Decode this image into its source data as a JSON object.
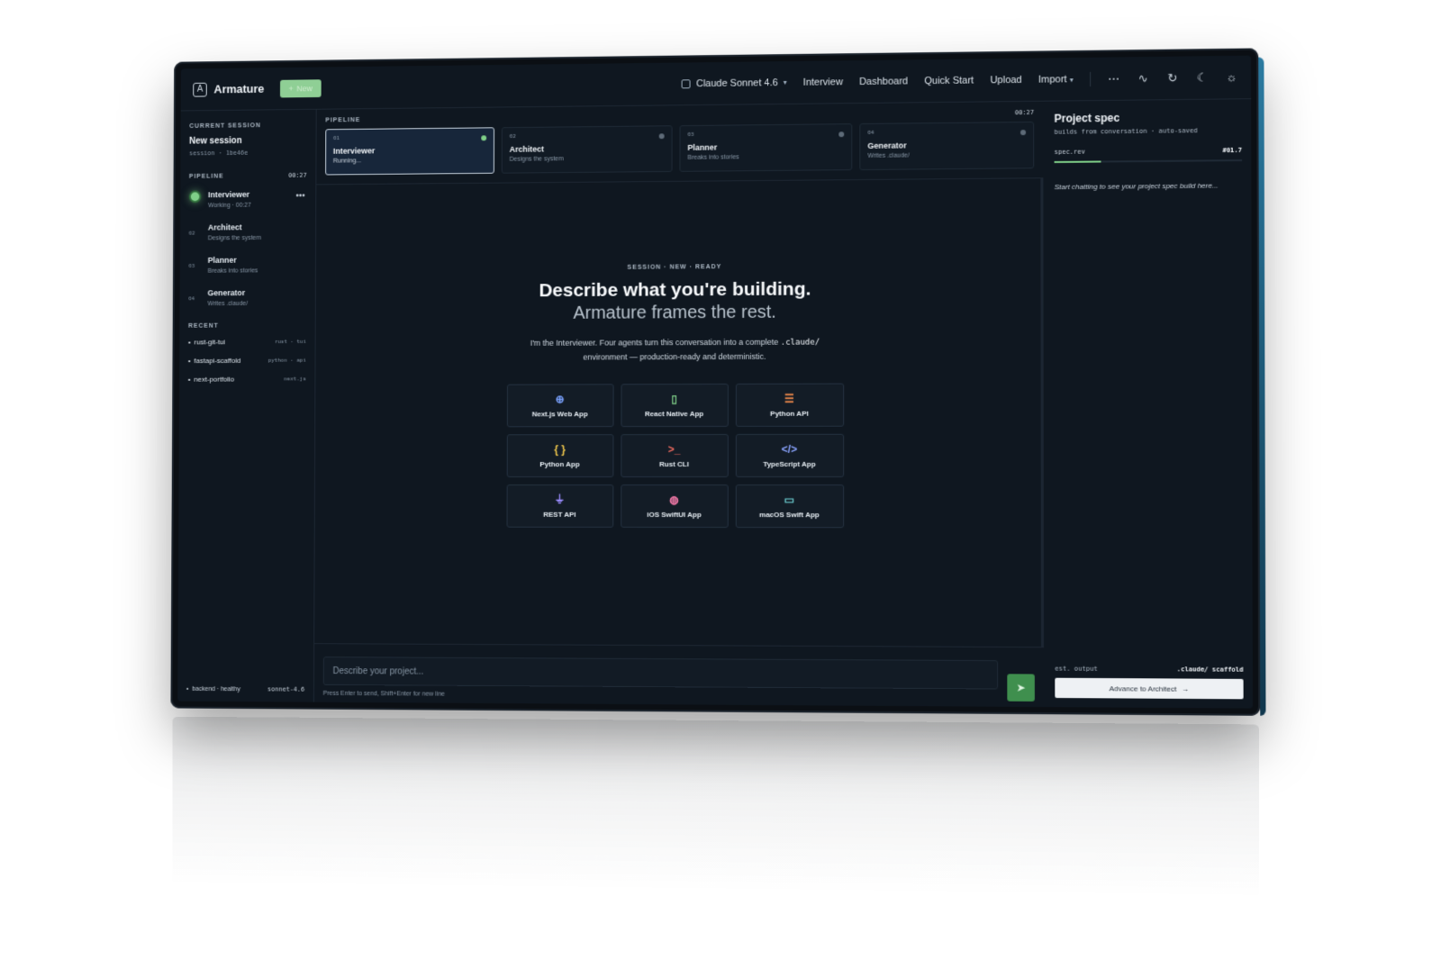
{
  "header": {
    "brand": "Armature",
    "new_label": "New",
    "model": "Claude Sonnet 4.6",
    "nav": [
      "Interview",
      "Dashboard",
      "Quick Start",
      "Upload",
      "Import"
    ],
    "icons": [
      "more-icon",
      "activity-icon",
      "refresh-icon",
      "moon-icon",
      "sun-icon"
    ]
  },
  "sidebar": {
    "current_kicker": "CURRENT SESSION",
    "session_title": "New session",
    "session_id": "session · 1be46e",
    "pipeline_kicker": "PIPELINE",
    "pipeline_time": "00:27",
    "stages": [
      {
        "num": "01",
        "name": "Interviewer",
        "sub": "Working · 00:27",
        "active": true
      },
      {
        "num": "02",
        "name": "Architect",
        "sub": "Designs the system"
      },
      {
        "num": "03",
        "name": "Planner",
        "sub": "Breaks into stories"
      },
      {
        "num": "04",
        "name": "Generator",
        "sub": "Writes .claude/"
      }
    ],
    "recent_kicker": "RECENT",
    "recent": [
      {
        "name": "rust-git-tui",
        "tag": "rust · tui"
      },
      {
        "name": "fastapi-scaffold",
        "tag": "python · api"
      },
      {
        "name": "next-portfolio",
        "tag": "next.js"
      }
    ],
    "footer_status": "backend · healthy",
    "footer_model": "sonnet-4.6"
  },
  "pipeline": {
    "kicker": "PIPELINE",
    "time": "00:27",
    "cards": [
      {
        "num": "01",
        "name": "Interviewer",
        "sub": "Running..."
      },
      {
        "num": "02",
        "name": "Architect",
        "sub": "Designs the system"
      },
      {
        "num": "03",
        "name": "Planner",
        "sub": "Breaks into stories"
      },
      {
        "num": "04",
        "name": "Generator",
        "sub": "Writes .claude/"
      }
    ]
  },
  "hero": {
    "kicker": "SESSION · NEW · READY",
    "headline": "Describe what you're building.",
    "headline2": "Armature frames the rest.",
    "lead_pre": "I'm the Interviewer. Four agents turn this conversation into a complete ",
    "lead_code": ".claude/",
    "lead_post": " environment — production-ready and deterministic."
  },
  "templates": [
    {
      "label": "Next.js Web App",
      "icon": "globe-icon",
      "glyph": "⊕",
      "color": "#7aa2ff"
    },
    {
      "label": "React Native App",
      "icon": "phone-icon",
      "glyph": "▯",
      "color": "#7fcf88"
    },
    {
      "label": "Python API",
      "icon": "server-icon",
      "glyph": "☰",
      "color": "#f08a4b"
    },
    {
      "label": "Python App",
      "icon": "braces-icon",
      "glyph": "{ }",
      "color": "#f2c94c"
    },
    {
      "label": "Rust CLI",
      "icon": "terminal-icon",
      "glyph": ">_",
      "color": "#f06a5f"
    },
    {
      "label": "TypeScript App",
      "icon": "code-icon",
      "glyph": "</>",
      "color": "#8aa4ff"
    },
    {
      "label": "REST API",
      "icon": "plug-icon",
      "glyph": "⏚",
      "color": "#9b8cff"
    },
    {
      "label": "iOS SwiftUI App",
      "icon": "apple-icon",
      "glyph": "◍",
      "color": "#ff7fb0"
    },
    {
      "label": "macOS Swift App",
      "icon": "monitor-icon",
      "glyph": "▭",
      "color": "#6fd3d6"
    }
  ],
  "composer": {
    "placeholder": "Describe your project...",
    "hint": "Press Enter to send, Shift+Enter for new line"
  },
  "spec": {
    "title": "Project spec",
    "subtitle": "builds from conversation · auto-saved",
    "rev_label": "spec.rev",
    "rev_value": "#01.7",
    "rev_progress": 0.25,
    "empty_text": "Start chatting to see your project spec build here...",
    "out_label": "est. output",
    "out_value": ".claude/ scaffold",
    "advance_label": "Advance to Architect",
    "advance_arrow": "→"
  },
  "colors": {
    "accent_green": "#7fcf88",
    "send_green": "#3f8f4e",
    "bg": "#0f1720"
  }
}
